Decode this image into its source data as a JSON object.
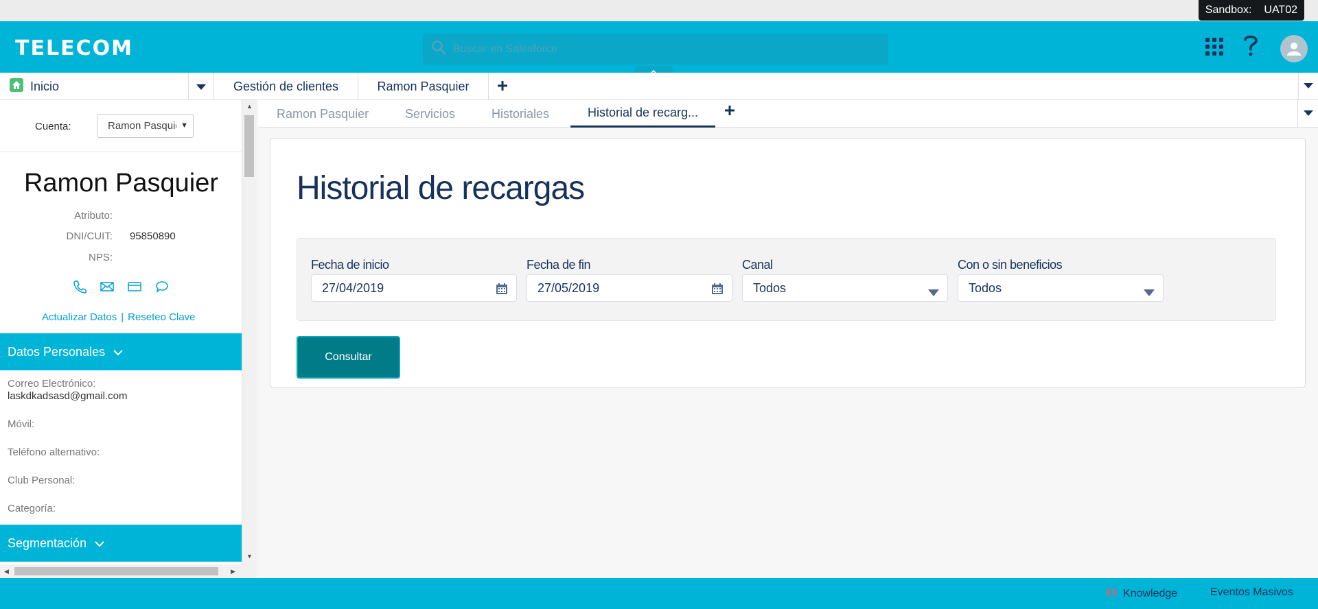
{
  "sandbox": {
    "label": "Sandbox:",
    "value": "UAT02"
  },
  "header": {
    "logo": "TELECOM",
    "search_placeholder": "Buscar en Salesforce"
  },
  "nav": {
    "home": "Inicio",
    "tabs": [
      "Gestión de clientes",
      "Ramon Pasquier"
    ]
  },
  "left": {
    "cuenta_label": "Cuenta:",
    "cuenta_value": "Ramon Pasquier",
    "name": "Ramon Pasquier",
    "atributo_label": "Atributo:",
    "dni_label": "DNI/CUIT:",
    "dni_value": "95850890",
    "nps_label": "NPS:",
    "link_update": "Actualizar Datos",
    "link_sep": "|",
    "link_reset": "Reseteo Clave",
    "section_personal": "Datos Personales",
    "email_label": "Correo Electrónico:",
    "email_value": "laskdkadsasd@gmail.com",
    "movil_label": "Móvil:",
    "telefono_label": "Teléfono alternativo:",
    "club_label": "Club Personal:",
    "categoria_label": "Categoría:",
    "section_segmentacion": "Segmentación"
  },
  "subtabs": [
    "Ramon Pasquier",
    "Servicios",
    "Historiales",
    "Historial de recarg..."
  ],
  "main": {
    "title": "Historial de recargas",
    "fecha_inicio_label": "Fecha de inicio",
    "fecha_inicio_value": "27/04/2019",
    "fecha_fin_label": "Fecha de fin",
    "fecha_fin_value": "27/05/2019",
    "canal_label": "Canal",
    "canal_value": "Todos",
    "beneficios_label": "Con o sin beneficios",
    "beneficios_value": "Todos",
    "consultar": "Consultar"
  },
  "footer": {
    "knowledge": "Knowledge",
    "eventos": "Eventos Masivos"
  },
  "colors": {
    "brand": "#00b4d8",
    "navy": "#16325c",
    "button": "#027b89"
  }
}
